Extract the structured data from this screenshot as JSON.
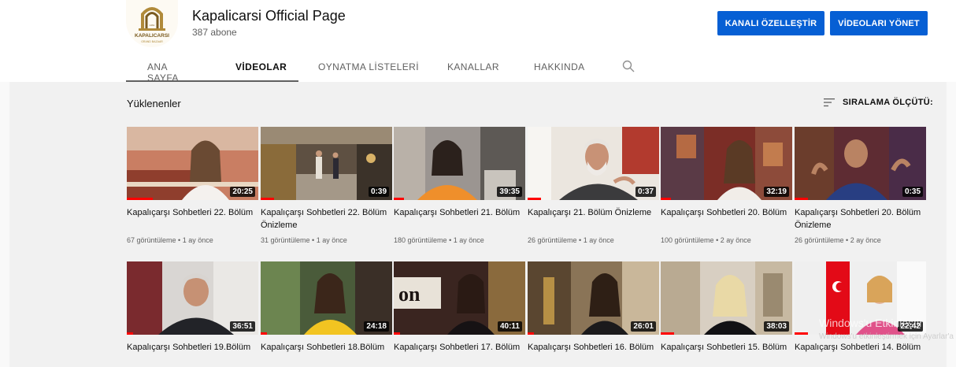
{
  "channel": {
    "name": "Kapalicarsi Official Page",
    "subscribers": "387 abone",
    "logo_text": "KAPALICARSI",
    "logo_sub": "GRAND BAZAAR",
    "logo_year": "1461"
  },
  "actions": {
    "customize": "KANALI ÖZELLEŞTİR",
    "manage": "VİDEOLARI YÖNET"
  },
  "tabs": [
    {
      "label": "ANA SAYFA"
    },
    {
      "label": "VİDEOLAR"
    },
    {
      "label": "OYNATMA LİSTELERİ"
    },
    {
      "label": "KANALLAR"
    },
    {
      "label": "HAKKINDA"
    }
  ],
  "section": {
    "title": "Yüklenenler",
    "sort_label": "SIRALAMA ÖLÇÜTÜ:"
  },
  "videos": [
    {
      "title": "Kapalıçarşı Sohbetleri 22. Bölüm",
      "duration": "20:25",
      "views": "67 görüntüleme",
      "age": "1 ay önce"
    },
    {
      "title": "Kapalıçarşı Sohbetleri 22. Bölüm Önizleme",
      "duration": "0:39",
      "views": "31 görüntüleme",
      "age": "1 ay önce"
    },
    {
      "title": "Kapalıçarşı Sohbetleri 21. Bölüm",
      "duration": "39:35",
      "views": "180 görüntüleme",
      "age": "1 ay önce"
    },
    {
      "title": "Kapalıçarşı 21. Bölüm Önizleme",
      "duration": "0:37",
      "views": "26 görüntüleme",
      "age": "1 ay önce"
    },
    {
      "title": "Kapalıçarşı Sohbetleri 20. Bölüm",
      "duration": "32:19",
      "views": "100 görüntüleme",
      "age": "2 ay önce"
    },
    {
      "title": "Kapalıçarşı Sohbetleri 20. Bölüm Önizleme",
      "duration": "0:35",
      "views": "26 görüntüleme",
      "age": "2 ay önce"
    },
    {
      "title": "Kapalıçarşı Sohbetleri 19.Bölüm",
      "duration": "36:51"
    },
    {
      "title": "Kapalıçarşı Sohbetleri 18.Bölüm",
      "duration": "24:18"
    },
    {
      "title": "Kapalıçarşı Sohbetleri 17. Bölüm",
      "duration": "40:11"
    },
    {
      "title": "Kapalıçarşı Sohbetleri 16. Bölüm",
      "duration": "26:01"
    },
    {
      "title": "Kapalıçarşı Sohbetleri 15. Bölüm",
      "duration": "38:03"
    },
    {
      "title": "Kapalıçarşı Sohbetleri 14. Bölüm",
      "duration": "22:42"
    }
  ],
  "watermark": {
    "line1": "Windows'u Etkinleştir",
    "line2": "Windows'u etkinleştirmek için Ayarlar'a gidin."
  }
}
